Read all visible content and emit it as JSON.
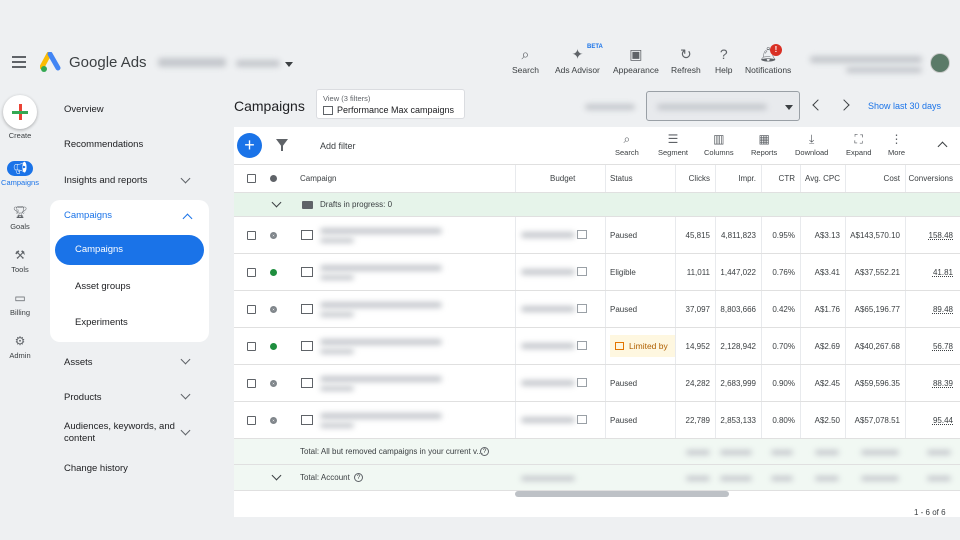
{
  "app": {
    "brand": "Google Ads"
  },
  "toolbar": [
    {
      "id": "search",
      "label": "Search",
      "icon": "search-icon"
    },
    {
      "id": "advisor",
      "label": "Ads Advisor",
      "icon": "sparkle-icon"
    },
    {
      "id": "appearance",
      "label": "Appearance",
      "icon": "appearance-icon"
    },
    {
      "id": "refresh",
      "label": "Refresh",
      "icon": "refresh-icon"
    },
    {
      "id": "help",
      "label": "Help",
      "icon": "help-icon"
    },
    {
      "id": "notifications",
      "label": "Notifications",
      "icon": "bell-icon"
    }
  ],
  "beta_label": "BETA",
  "notif_badge": "!",
  "rail": [
    {
      "label": "Create"
    },
    {
      "label": "Campaigns"
    },
    {
      "label": "Goals"
    },
    {
      "label": "Tools"
    },
    {
      "label": "Billing"
    },
    {
      "label": "Admin"
    }
  ],
  "nav": {
    "overview": "Overview",
    "recommendations": "Recommendations",
    "insights": "Insights and reports",
    "campaigns_group": "Campaigns",
    "sub": [
      "Campaigns",
      "Asset groups",
      "Experiments"
    ],
    "assets": "Assets",
    "products": "Products",
    "audiences": "Audiences, keywords, and content",
    "change_history": "Change history"
  },
  "main": {
    "title": "Campaigns",
    "view_line1": "View (3 filters)",
    "view_line2": "Performance Max campaigns",
    "show_last": "Show last 30 days",
    "add_filter": "Add filter",
    "table_tools": [
      "Search",
      "Segment",
      "Columns",
      "Reports",
      "Download",
      "Expand",
      "More"
    ]
  },
  "table": {
    "headers": {
      "campaign": "Campaign",
      "budget": "Budget",
      "status": "Status",
      "clicks": "Clicks",
      "impr": "Impr.",
      "ctr": "CTR",
      "cpc": "Avg. CPC",
      "cost": "Cost",
      "conv": "Conversions"
    },
    "drafts": "Drafts in progress: 0",
    "rows": [
      {
        "status": "Paused",
        "state": "paused",
        "clicks": "45,815",
        "impr": "4,811,823",
        "ctr": "0.95%",
        "cpc": "A$3.13",
        "cost": "A$143,570.10",
        "conv": "158.48"
      },
      {
        "status": "Eligible",
        "state": "enabled",
        "clicks": "11,011",
        "impr": "1,447,022",
        "ctr": "0.76%",
        "cpc": "A$3.41",
        "cost": "A$37,552.21",
        "conv": "41.81"
      },
      {
        "status": "Paused",
        "state": "paused",
        "clicks": "37,097",
        "impr": "8,803,666",
        "ctr": "0.42%",
        "cpc": "A$1.76",
        "cost": "A$65,196.77",
        "conv": "89.48"
      },
      {
        "status": "Limited by",
        "state": "enabled",
        "limited": true,
        "clicks": "14,952",
        "impr": "2,128,942",
        "ctr": "0.70%",
        "cpc": "A$2.69",
        "cost": "A$40,267.68",
        "conv": "56.78"
      },
      {
        "status": "Paused",
        "state": "paused",
        "clicks": "24,282",
        "impr": "2,683,999",
        "ctr": "0.90%",
        "cpc": "A$2.45",
        "cost": "A$59,596.35",
        "conv": "88.39"
      },
      {
        "status": "Paused",
        "state": "paused",
        "clicks": "22,789",
        "impr": "2,853,133",
        "ctr": "0.80%",
        "cpc": "A$2.50",
        "cost": "A$57,078.51",
        "conv": "95.44"
      }
    ],
    "total_filtered": "Total: All but removed campaigns in your current v...",
    "total_account": "Total: Account",
    "pager": "1 - 6 of 6"
  }
}
